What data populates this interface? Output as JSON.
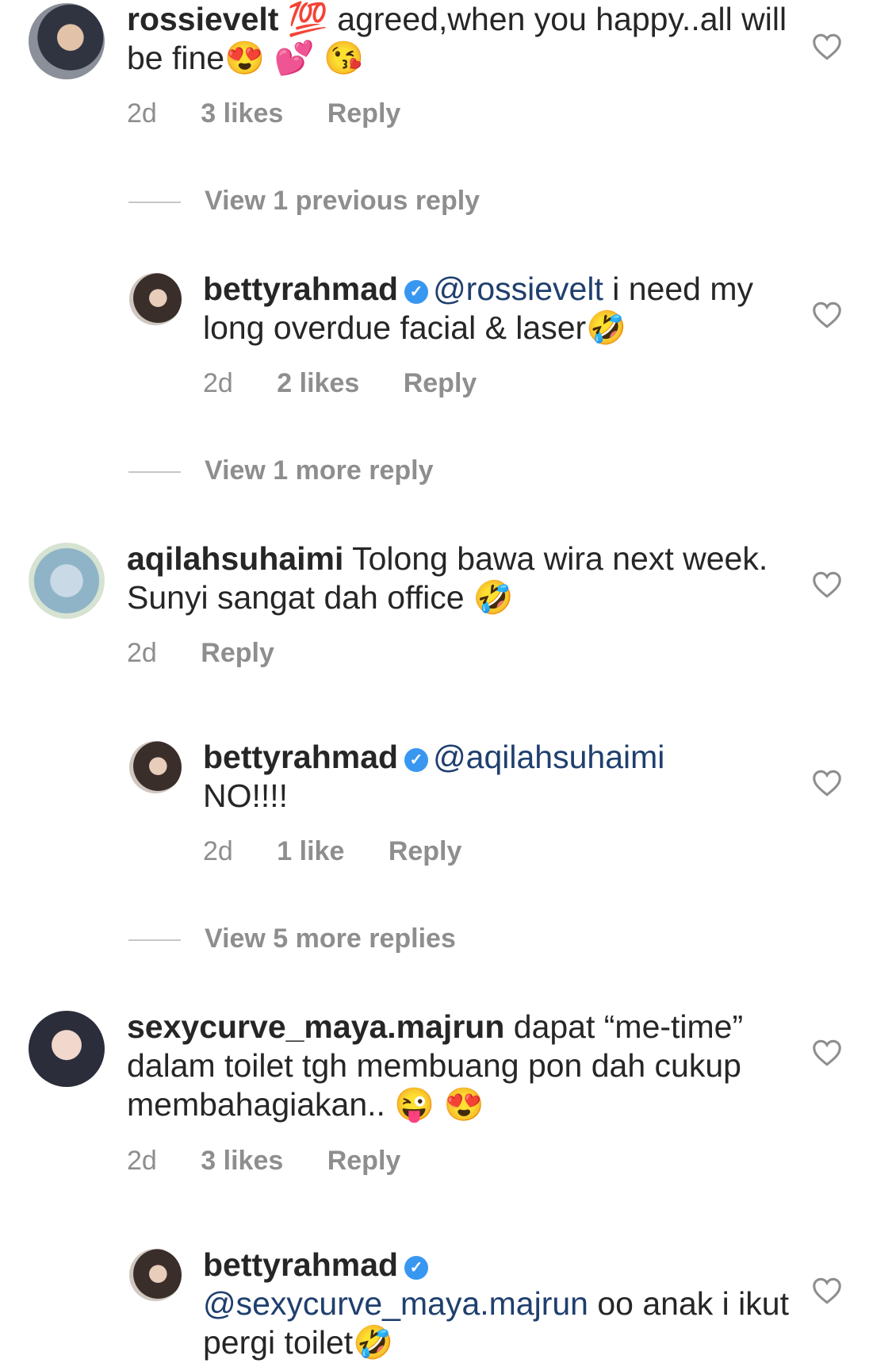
{
  "comments": [
    {
      "user": "rossievelt",
      "text": "💯 agreed,when you happy..all will be fine😍 💕 😘",
      "time": "2d",
      "likes": "3 likes",
      "reply": "Reply"
    },
    {
      "view_replies": "View 1 previous reply"
    },
    {
      "user": "bettyrahmad",
      "verified_icon": "verified-badge-icon",
      "mention": "@rossievelt",
      "text": " i need my long overdue facial & laser🤣",
      "time": "2d",
      "likes": "2 likes",
      "reply": "Reply"
    },
    {
      "view_replies": "View 1 more reply"
    },
    {
      "user": "aqilahsuhaimi",
      "text": " Tolong bawa wira next week. Sunyi sangat dah office 🤣",
      "time": "2d",
      "reply": "Reply"
    },
    {
      "user": "bettyrahmad",
      "mention": "@aqilahsuhaimi",
      "text": " NO!!!!",
      "time": "2d",
      "likes": "1 like",
      "reply": "Reply"
    },
    {
      "view_replies": "View 5 more replies"
    },
    {
      "user": "sexycurve_maya.majrun",
      "text": " dapat “me-time” dalam toilet tgh membuang pon dah cukup membahagiakan.. 😜 😍",
      "time": "2d",
      "likes": "3 likes",
      "reply": "Reply"
    },
    {
      "user": "bettyrahmad",
      "mention": "@sexycurve_maya.majrun",
      "text": " oo anak i ikut pergi toilet🤣"
    }
  ],
  "icons": {
    "heart": "heart-outline-icon",
    "verified": "verified-badge-icon"
  },
  "colors": {
    "text": "#262626",
    "meta": "#8e8e8e",
    "mention": "#1f3f6e",
    "verified": "#3897f0"
  }
}
